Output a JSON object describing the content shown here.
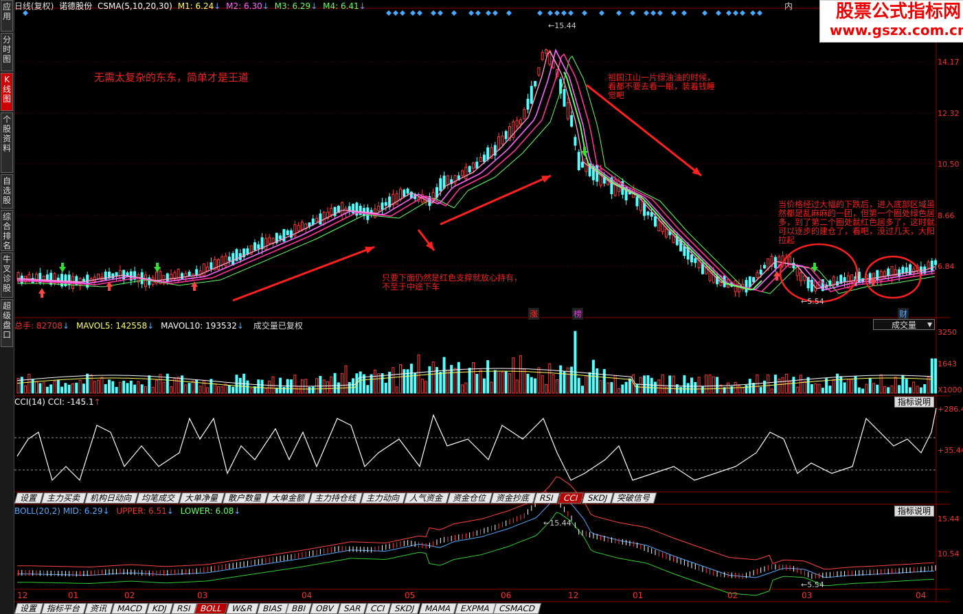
{
  "left_tabs": [
    "应用",
    "分时图",
    "K线图",
    "个股资料",
    "自选股",
    "综合排名",
    "牛叉诊股",
    "超级盘口"
  ],
  "active_left_tab": 2,
  "main": {
    "header": {
      "period": "日线(复权)",
      "stock": "诺德股份",
      "indicator": "CSMA(5,10,20,30)",
      "m1": "M1: 6.24",
      "m2": "M2: 6.30",
      "m3": "M3: 6.29",
      "m4": "M4: 6.41"
    },
    "corner_text": "内",
    "price_labels": [
      "14.17",
      "12.32",
      "10.50",
      "8.66",
      "6.84"
    ],
    "high_label": "15.44",
    "low_label": "5.54",
    "markers": [
      "涨",
      "榜",
      "财"
    ],
    "annotations": {
      "top_left": "无需太复杂的东东，简单才是王道",
      "bottom_mid": "只要下面仍然是红色支撑就放心持有，不至于中途下车",
      "top_right": "祖国江山一片绿油油的时候，看都不要去看一眼，装着钱睡觉吧",
      "right": "当价格经过大幅的下跌后，进入底部区域虽然都是乱麻麻的一团，但第一个圈处绿色居多，到了第二个圈处就红色居多了，这时就可以逐步的建仓了，看吧，没过几天，大阳拉起"
    }
  },
  "logo": {
    "line1": "股票公式指标网",
    "line2": "www.gszx.com.cn"
  },
  "volume": {
    "header": {
      "total": "总手: 82708",
      "mavol5": "MAVOL5: 142558",
      "mavol10": "MAVOL10: 193532",
      "note": "成交量已复权"
    },
    "selector": "成交量",
    "labels": [
      "3250",
      "1643",
      "X1000"
    ]
  },
  "cci": {
    "header": "CCI(14)  CCI: -145.1",
    "explain_button": "指标说明",
    "labels": [
      "+286.4",
      "+35.44"
    ]
  },
  "indicator_tabs": [
    "设置",
    "主力买卖",
    "机构日动向",
    "均笔成交",
    "大单净量",
    "散户数量",
    "大单金额",
    "主力持仓线",
    "主力动向",
    "人气资金",
    "资金仓位",
    "资金抄底",
    "RSI",
    "CCI",
    "SKDJ",
    "突破信号"
  ],
  "indicator_tabs_active": 13,
  "boll": {
    "header": {
      "name": "BOLL(20,2)",
      "mid": "MID: 6.29",
      "upper": "UPPER: 6.51",
      "lower": "LOWER: 6.08"
    },
    "explain_button": "指标说明",
    "labels": [
      "15.44",
      "10.54"
    ],
    "high_label": "15.44",
    "low_label": "5.54"
  },
  "months": [
    "12",
    "01",
    "02",
    "03",
    "04",
    "05",
    "06",
    "12",
    "01",
    "02",
    "03",
    "04"
  ],
  "bottom_tabs": [
    "设置",
    "指标平台",
    "资讯",
    "MACD",
    "KDJ",
    "RSI",
    "BOLL",
    "W&R",
    "BIAS",
    "BBI",
    "OBV",
    "SAR",
    "CCI",
    "SKDJ",
    "MAMA",
    "EXPMA",
    "CSMACD"
  ],
  "bottom_tabs_active": 6,
  "colors": {
    "up": "#ff3b3b",
    "down": "#54ffff",
    "m1": "#ffffff",
    "m2": "#ff66ff",
    "m3": "#ff3399",
    "m4": "#66ff66",
    "grid": "#8b0000"
  }
}
